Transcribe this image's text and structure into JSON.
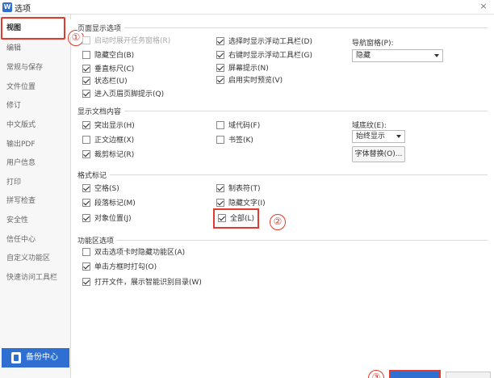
{
  "window": {
    "title": "选项",
    "app_icon": "W",
    "close_glyph": "×"
  },
  "sidebar": {
    "items": [
      {
        "label": "视图"
      },
      {
        "label": "编辑"
      },
      {
        "label": "常规与保存"
      },
      {
        "label": "文件位置"
      },
      {
        "label": "修订"
      },
      {
        "label": "中文版式"
      },
      {
        "label": "输出PDF"
      },
      {
        "label": "用户信息"
      },
      {
        "label": "打印"
      },
      {
        "label": "拼写检查"
      },
      {
        "label": "安全性"
      },
      {
        "label": "信任中心"
      },
      {
        "label": "自定义功能区"
      },
      {
        "label": "快速访问工具栏"
      }
    ],
    "backup_label": "备份中心"
  },
  "markers": {
    "one": "①",
    "two": "②",
    "three": "③"
  },
  "page_display": {
    "title": "页面显示选项",
    "options": [
      {
        "label": "启动时展开任务窗格(R)",
        "checked": false,
        "disabled": true
      },
      {
        "label": "隐藏空白(B)",
        "checked": false
      },
      {
        "label": "垂直标尺(C)",
        "checked": true
      },
      {
        "label": "状态栏(U)",
        "checked": true
      },
      {
        "label": "进入页眉页脚提示(Q)",
        "checked": true
      },
      {
        "label": "选择时显示浮动工具栏(D)",
        "checked": true
      },
      {
        "label": "右键时显示浮动工具栏(G)",
        "checked": true
      },
      {
        "label": "屏幕提示(N)",
        "checked": true
      },
      {
        "label": "启用实时预览(V)",
        "checked": true
      }
    ],
    "nav_label": "导航窗格(P):",
    "nav_value": "隐藏"
  },
  "doc_content": {
    "title": "显示文档内容",
    "options": [
      {
        "label": "突出显示(H)",
        "checked": true
      },
      {
        "label": "正文边框(X)",
        "checked": false
      },
      {
        "label": "裁剪标记(R)",
        "checked": true
      },
      {
        "label": "域代码(F)",
        "checked": false
      },
      {
        "label": "书签(K)",
        "checked": false
      }
    ],
    "shading_label": "域底纹(E):",
    "shading_value": "始终显示",
    "font_replace_label": "字体替换(O)..."
  },
  "format_marks": {
    "title": "格式标记",
    "options": [
      {
        "label": "空格(S)",
        "checked": true
      },
      {
        "label": "段落标记(M)",
        "checked": true
      },
      {
        "label": "对象位置(J)",
        "checked": true
      },
      {
        "label": "制表符(T)",
        "checked": true
      },
      {
        "label": "隐藏文字(I)",
        "checked": true
      },
      {
        "label": "全部(L)",
        "checked": true
      }
    ]
  },
  "ribbon": {
    "title": "功能区选项",
    "options": [
      {
        "label": "双击选项卡时隐藏功能区(A)",
        "checked": false
      },
      {
        "label": "单击方框时打勾(O)",
        "checked": true
      },
      {
        "label": "打开文件，展示智能识别目录(W)",
        "checked": true
      }
    ]
  },
  "colors": {
    "accent": "#2f6fd1",
    "highlight": "#e23a2e"
  }
}
